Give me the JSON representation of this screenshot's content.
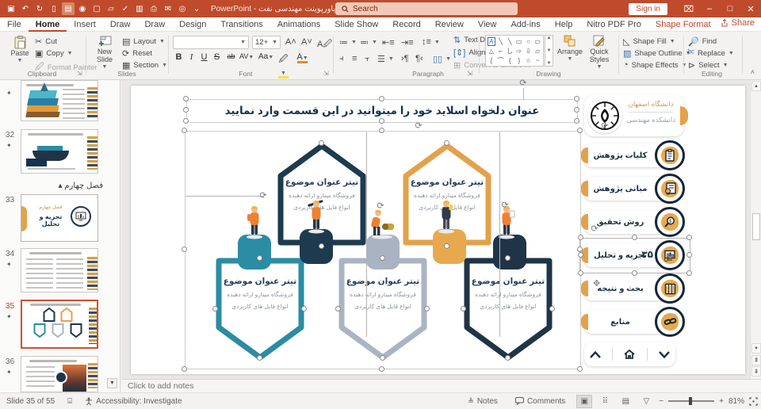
{
  "colors": {
    "titlebar": "#bf4b2c",
    "accent": "#c0492c",
    "navy": "#1e3a4f",
    "orange": "#e2a24b",
    "teal": "#2b8ca3",
    "slate": "#aab4c4",
    "dark": "#203448",
    "selection_border": "#d0502e"
  },
  "titlebar": {
    "title": "قالب پاورپوینت مهندسی نفت - PowerPoint",
    "search_label": "Search",
    "sign_in_label": "Sign in"
  },
  "menubar": {
    "tabs": [
      "File",
      "Home",
      "Insert",
      "Draw",
      "Draw",
      "Design",
      "Transitions",
      "Animations",
      "Slide Show",
      "Record",
      "Review",
      "View",
      "Add-ins",
      "Help",
      "Nitro PDF Pro",
      "Shape Format"
    ],
    "share_label": "Share"
  },
  "ribbon": {
    "clipboard": {
      "group": "Clipboard",
      "paste": "Paste",
      "cut": "Cut",
      "copy": "Copy",
      "format_painter": "Format Painter"
    },
    "slides": {
      "group": "Slides",
      "new_slide": "New Slide",
      "layout": "Layout",
      "reset": "Reset",
      "section": "Section"
    },
    "font": {
      "group": "Font",
      "size": "12+",
      "bold": "B",
      "italic": "I",
      "underline": "U",
      "strike": "S",
      "strike2": "ab",
      "spacing": "AV",
      "case": "Aa",
      "grow": "A",
      "shrink": "A",
      "clear": "A"
    },
    "paragraph": {
      "group": "Paragraph",
      "text_direction": "Text Direction",
      "align_text": "Align Text",
      "convert": "Convert to SmartArt"
    },
    "drawing": {
      "group": "Drawing",
      "arrange": "Arrange",
      "quick_styles": "Quick Styles"
    },
    "shape": {
      "fill": "Shape Fill",
      "outline": "Shape Outline",
      "effects": "Shape Effects"
    },
    "editing": {
      "group": "Editing",
      "find": "Find",
      "replace": "Replace",
      "select": "Select"
    }
  },
  "thumbnails": {
    "section_label": "فصل چهارم",
    "items": [
      {
        "number": "",
        "kind": "oilrig"
      },
      {
        "number": "32",
        "kind": "ship"
      },
      {
        "number": "33",
        "kind": "chapter",
        "chapter_tag": "فصل چهارم",
        "chapter_title": "تجزیه و تحلیل"
      },
      {
        "number": "34",
        "kind": "text"
      },
      {
        "number": "35",
        "kind": "hexagons",
        "selected": true
      },
      {
        "number": "36",
        "kind": "photo"
      }
    ]
  },
  "slide": {
    "title": "عنوان دلخواه اسلاید خود را میتوانید در این قسمت وارد نمایید",
    "hexagons": [
      {
        "title": "تیتر عنوان موضوع",
        "line1": "فروشگاه مینارو ارائه دهنده",
        "line2": "انواع فایل های کاربردی",
        "color": "#1e3a4f",
        "direction": "up"
      },
      {
        "title": "تیتر عنوان موضوع",
        "line1": "فروشگاه مینارو ارائه دهنده",
        "line2": "انواع فایل های کاربردی",
        "color": "#e2a24b",
        "direction": "up"
      },
      {
        "title": "تیتر عنوان موضوع",
        "line1": "فروشگاه مینارو ارائه دهنده",
        "line2": "انواع فایل های کاربردی",
        "color": "#2b8ca3",
        "direction": "down"
      },
      {
        "title": "تیتر عنوان موضوع",
        "line1": "فروشگاه مینارو ارائه دهنده",
        "line2": "انواع فایل های کاربردی",
        "color": "#aab4c4",
        "direction": "down"
      },
      {
        "title": "تیتر عنوان موضوع",
        "line1": "فروشگاه مینارو ارائه دهنده",
        "line2": "انواع فایل های کاربردی",
        "color": "#203448",
        "direction": "down"
      }
    ],
    "sidebar": {
      "university_name": "دانشگاه اصفهان",
      "faculty_name": "دانشکده مهندسی",
      "items": [
        {
          "label": "کلیات پژوهش"
        },
        {
          "label": "مبانی پژوهش"
        },
        {
          "label": "روش تحقیق"
        },
        {
          "label": "تجزیه و تحلیل",
          "badge": "۳۵",
          "selected": true
        },
        {
          "label": "بحث و نتیجه"
        },
        {
          "label": "منابع"
        }
      ]
    }
  },
  "notes": {
    "placeholder": "Click to add notes"
  },
  "statusbar": {
    "slide_info": "Slide 35 of 55",
    "accessibility": "Accessibility: Investigate",
    "notes_label": "Notes",
    "comments_label": "Comments",
    "zoom_percent": "81%"
  }
}
